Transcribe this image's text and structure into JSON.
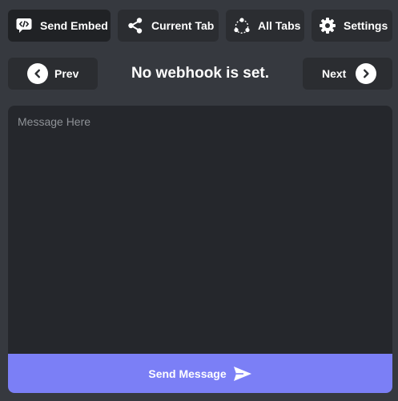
{
  "toolbar": {
    "items": [
      {
        "label": "Send Embed",
        "icon": "code-chat-icon",
        "active": true
      },
      {
        "label": "Current Tab",
        "icon": "share-icon"
      },
      {
        "label": "All Tabs",
        "icon": "nodes-icon"
      },
      {
        "label": "Settings",
        "icon": "gear-icon"
      }
    ]
  },
  "nav": {
    "prev_label": "Prev",
    "next_label": "Next",
    "status": "No webhook is set."
  },
  "composer": {
    "placeholder": "Message Here",
    "value": "",
    "send_label": "Send Message",
    "send_color": "#7b7ff6"
  },
  "colors": {
    "background": "#36393f",
    "button": "#2b2d31",
    "active_button": "#202225",
    "editor": "#25272c"
  }
}
